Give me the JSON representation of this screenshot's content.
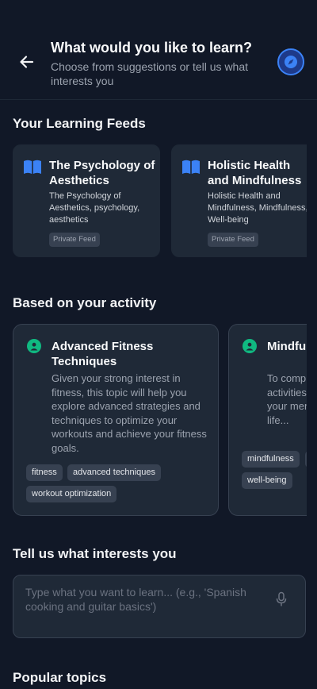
{
  "header": {
    "title": "What would you like to learn?",
    "subtitle": "Choose from suggestions or tell us what interests you"
  },
  "feeds_section": {
    "title": "Your Learning Feeds",
    "items": [
      {
        "title": "The Psychology of Aesthetics",
        "description": "The Psychology of Aesthetics, psychology, aesthetics",
        "badge": "Private Feed"
      },
      {
        "title": "Holistic Health and Mindfulness",
        "description": "Holistic Health and Mindfulness, Mindfulness, Well-being",
        "badge": "Private Feed"
      }
    ]
  },
  "activity_section": {
    "title": "Based on your activity",
    "items": [
      {
        "title": "Advanced Fitness Techniques",
        "description": "Given your strong interest in fitness, this topic will help you explore advanced strategies and techniques to optimize your workouts and achieve your fitness goals.",
        "tags": [
          "fitness",
          "advanced techniques",
          "workout optimization"
        ]
      },
      {
        "title": "Mindfulness and Fitness",
        "description": "To complement your fitness activities, mindfulness can enhance your mental well-being and overall life...",
        "tags": [
          "mindfulness",
          "",
          "well-being"
        ]
      }
    ]
  },
  "interests_section": {
    "title": "Tell us what interests you",
    "placeholder": "Type what you want to learn... (e.g., 'Spanish cooking and guitar basics')"
  },
  "popular_section": {
    "title": "Popular topics"
  },
  "colors": {
    "background": "#111827",
    "card": "#1f2937",
    "accent_blue": "#3b82f6",
    "accent_green": "#10b981"
  }
}
